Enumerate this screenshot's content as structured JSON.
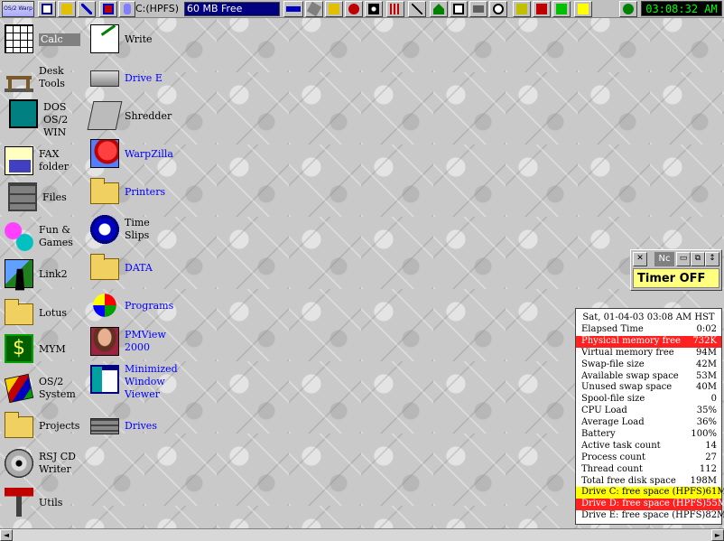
{
  "launchpad": {
    "logo_text": "OS/2 Warp",
    "drive": "C:(HPFS)",
    "free_space": "60 MB Free",
    "clock": "03:08:32 AM",
    "buttons": [
      "window-list-icon",
      "lock-icon",
      "find-icon",
      "shutdown-icon",
      "drive-icon",
      "free-space-icon",
      "memory-icon",
      "disk-icon",
      "folder-icon",
      "cd-icon",
      "settings-icon",
      "network-icon",
      "edit-icon",
      "home-icon",
      "monitor-icon",
      "printer-icon",
      "clock-icon",
      "program-icon",
      "system-icon",
      "help-icon",
      "info-icon"
    ]
  },
  "icons": {
    "calc": "Calc",
    "write": "Write",
    "desk_tools": "Desk\nTools",
    "drive_e": "Drive E",
    "dos": "DOS\nOS/2\nWIN",
    "shredder": "Shredder",
    "fax": "FAX\nfolder",
    "warpzilla": "WarpZilla",
    "files": "Files",
    "printers": "Printers",
    "fun_games": "Fun &\nGames",
    "time_slips": "Time\nSlips",
    "link2": "Link2",
    "data": "DATA",
    "lotus": "Lotus",
    "programs": "Programs",
    "mym": "MYM",
    "pmview": "PMView\n2000",
    "os2_system": "OS/2\nSystem",
    "minimized_viewer": "Minimized\nWindow\nViewer",
    "projects": "Projects",
    "drives": "Drives",
    "rsj_cd": "RSJ CD\nWriter",
    "utils": "Utils",
    "lotus_badge": "Lotus"
  },
  "timer": {
    "nc_label": "Nc",
    "display": "Timer OFF"
  },
  "sysmon": {
    "header": "Sat, 01-04-03 03:08 AM HST",
    "rows": [
      {
        "label": "Elapsed Time",
        "value": "0:02"
      },
      {
        "label": "Physical memory free",
        "value": "732K"
      },
      {
        "label": "Virtual memory free",
        "value": "94M"
      },
      {
        "label": "Swap-file size",
        "value": "42M"
      },
      {
        "label": "Available swap space",
        "value": "53M"
      },
      {
        "label": "Unused swap space",
        "value": "40M"
      },
      {
        "label": "Spool-file size",
        "value": "0"
      },
      {
        "label": "CPU Load",
        "value": "35%"
      },
      {
        "label": "Average Load",
        "value": "36%"
      },
      {
        "label": "Battery",
        "value": "100%"
      },
      {
        "label": "Active task count",
        "value": "14"
      },
      {
        "label": "Process count",
        "value": "27"
      },
      {
        "label": "Thread count",
        "value": "112"
      },
      {
        "label": "Total free disk space",
        "value": "198M"
      },
      {
        "label": "Drive C: free space (HPFS)",
        "value": "61M"
      },
      {
        "label": "Drive D: free space (HPFS)",
        "value": "55M"
      },
      {
        "label": "Drive E: free space (HPFS)",
        "value": "82M"
      }
    ]
  },
  "colors": {
    "highlight_red": "#ff2020",
    "highlight_yellow": "#ffff00",
    "timer_bg": "#ffff80",
    "clock_fg": "#00ff00",
    "free_bg": "#000080"
  }
}
